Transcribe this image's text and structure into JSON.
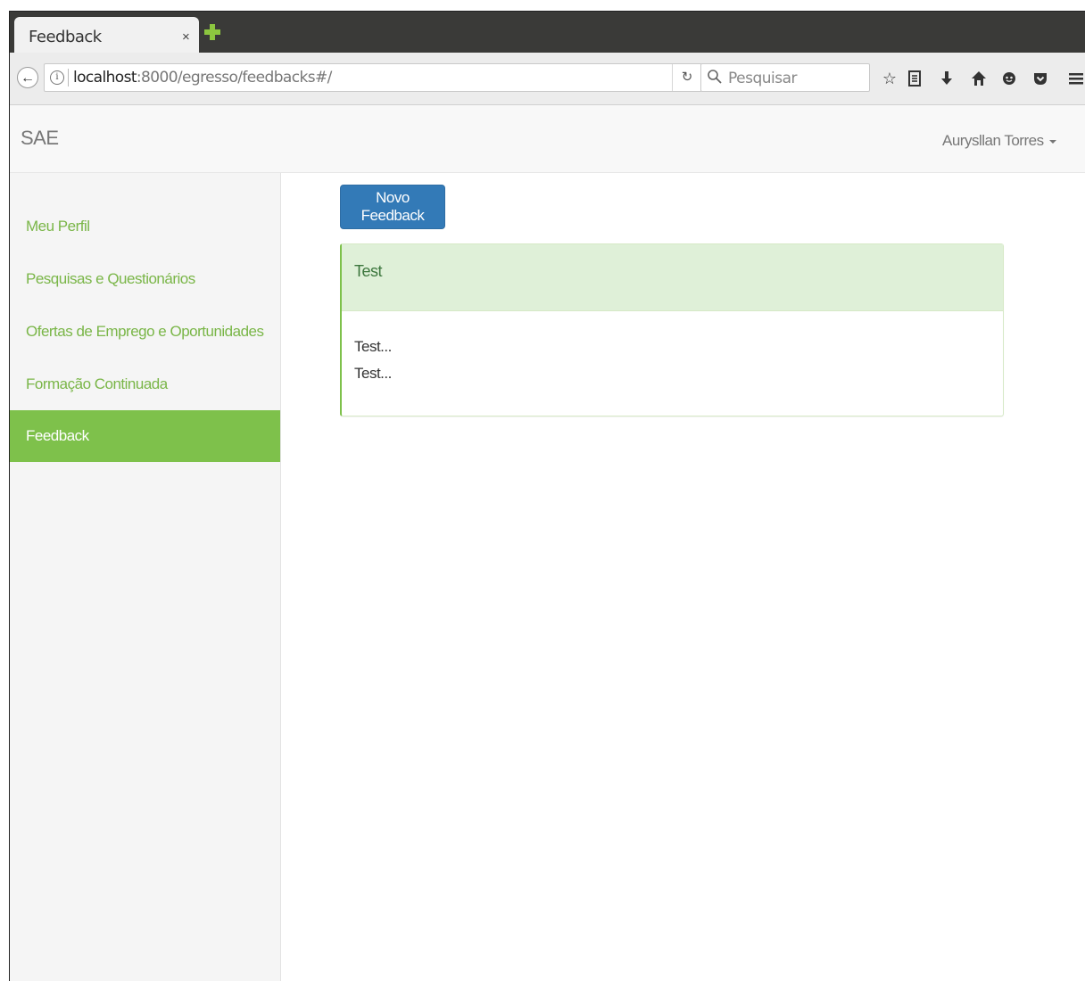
{
  "browser": {
    "tab_title": "Feedback",
    "tab_close": "×",
    "url_host": "localhost",
    "url_path": ":8000/egresso/feedbacks#/",
    "search_placeholder": "Pesquisar",
    "icons": [
      "back-arrow-icon",
      "info-icon",
      "reload-icon",
      "search-icon",
      "bookmark-star-icon",
      "reading-list-icon",
      "download-icon",
      "home-icon",
      "chat-icon",
      "pocket-icon",
      "menu-icon"
    ]
  },
  "navbar": {
    "brand": "SAE",
    "user_name": "Aurysllan Torres"
  },
  "sidebar": {
    "items": [
      {
        "label": "Meu Perfil",
        "active": false
      },
      {
        "label": "Pesquisas e Questionários",
        "active": false
      },
      {
        "label": "Ofertas de Emprego e Oportunidades",
        "active": false
      },
      {
        "label": "Formação Continuada",
        "active": false
      },
      {
        "label": "Feedback",
        "active": true
      }
    ]
  },
  "main": {
    "new_button": "Novo Feedback",
    "feedback": {
      "title": "Test",
      "lines": [
        "Test...",
        "Test..."
      ]
    }
  },
  "colors": {
    "accent_green": "#7ec14b",
    "primary_blue": "#337ab7",
    "panel_heading_bg": "#dff0d8"
  }
}
